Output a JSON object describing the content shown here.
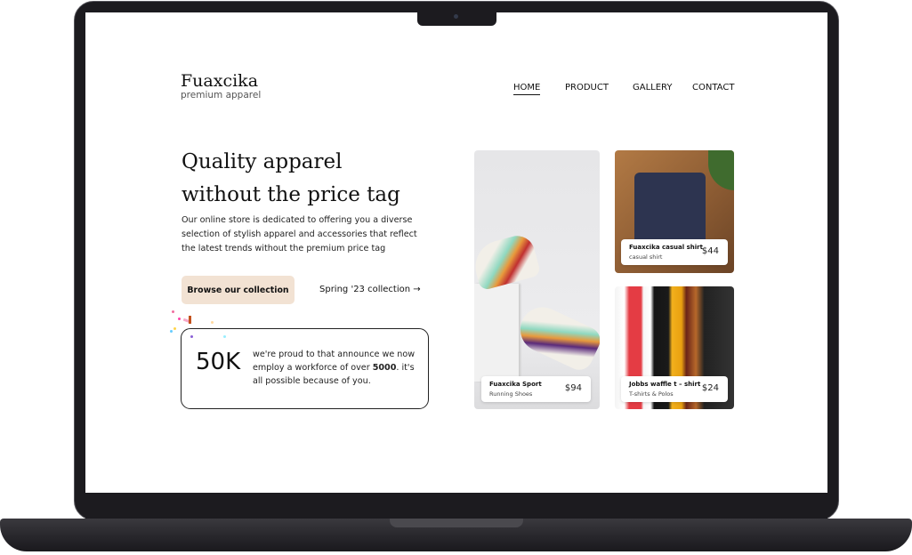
{
  "header": {
    "logo": "Fuaxcika",
    "tagline": "premium apparel",
    "nav": [
      {
        "label": "HOME",
        "active": true
      },
      {
        "label": "PRODUCT"
      },
      {
        "label": "GALLERY"
      },
      {
        "label": "CONTACT"
      }
    ]
  },
  "hero": {
    "title_line1": "Quality apparel",
    "title_line2": "without the price tag",
    "description": "Our online store is dedicated to offering you a diverse selection of stylish apparel and accessories that reflect the latest trends without the premium price tag",
    "primary_button": "Browse our collection",
    "secondary_link": "Spring '23 collection",
    "arrow_icon": "arrow-right-icon",
    "accent": "#f2e2d3"
  },
  "stat": {
    "number": "50K",
    "text_before": "we're proud to that announce we now employ a workforce of over ",
    "highlight": "5000",
    "text_after": ". it's all possible because of you."
  },
  "products": [
    {
      "name": "Fuaxcika Sport",
      "category": "Running Shoes",
      "price": "$94"
    },
    {
      "name": "Fuaxcika casual shirt",
      "category": "casual shirt",
      "price": "$44"
    },
    {
      "name": "Jobbs waffle t – shirt",
      "category": "T-shirts & Polos",
      "price": "$24"
    }
  ]
}
